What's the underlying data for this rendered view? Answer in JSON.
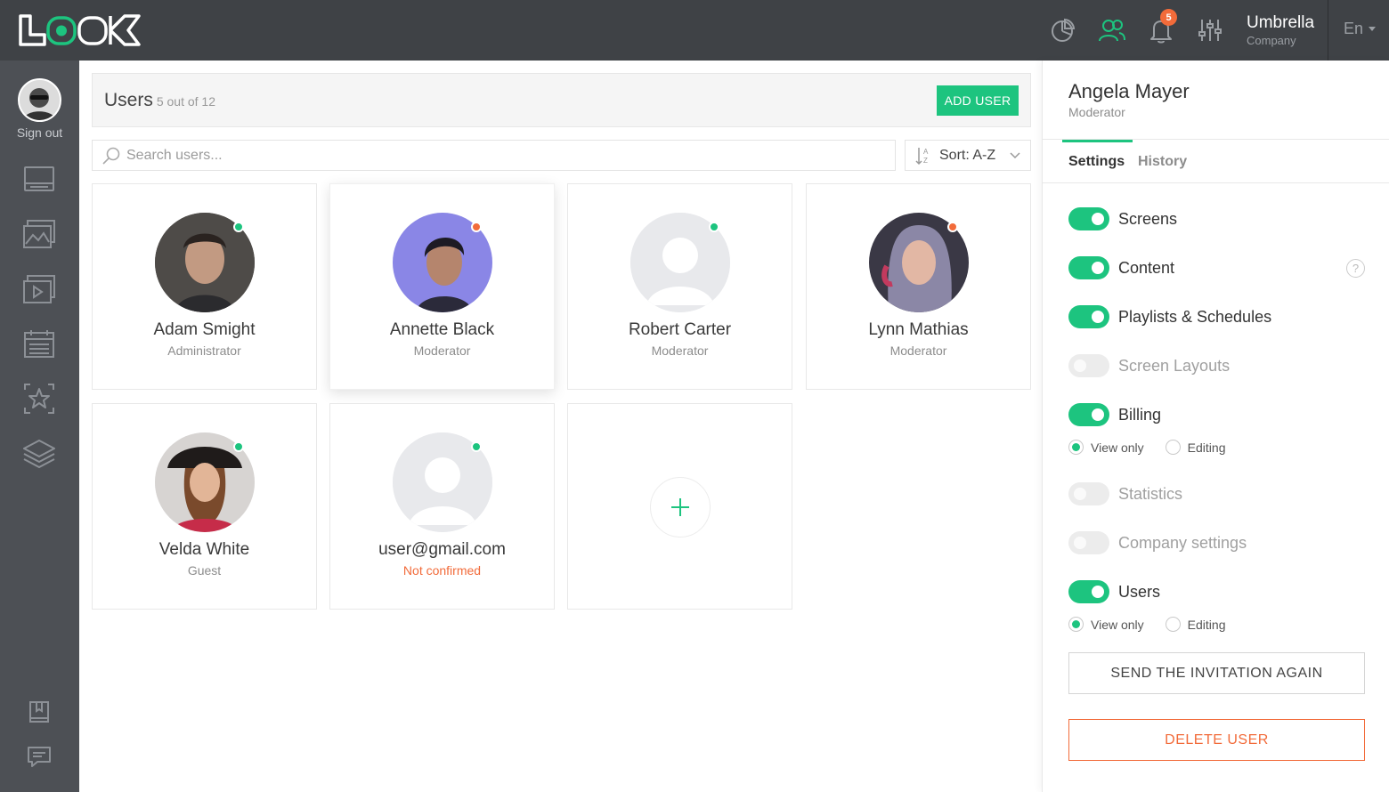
{
  "topbar": {
    "notifications_count": "5",
    "company_name": "Umbrella",
    "company_sub": "Company",
    "language": "En"
  },
  "sidebar": {
    "sign_out": "Sign out"
  },
  "header": {
    "title": "Users",
    "count": "5 out of 12",
    "add_user": "ADD USER"
  },
  "search": {
    "placeholder": "Search users...",
    "sort_label": "Sort: A-Z"
  },
  "users": [
    {
      "name": "Adam Smight",
      "role": "Administrator",
      "status_color": "#1dc47f"
    },
    {
      "name": "Annette Black",
      "role": "Moderator",
      "status_color": "#f26b3a"
    },
    {
      "name": "Robert Carter",
      "role": "Moderator",
      "status_color": "#1dc47f"
    },
    {
      "name": "Lynn Mathias",
      "role": "Moderator",
      "status_color": "#f26b3a"
    },
    {
      "name": "Velda White",
      "role": "Guest",
      "status_color": "#1dc47f"
    },
    {
      "name": "user@gmail.com",
      "role": "Not confirmed",
      "status_color": "#1dc47f"
    }
  ],
  "panel": {
    "name": "Angela Mayer",
    "role": "Moderator",
    "tabs": [
      "Settings",
      "History"
    ],
    "permissions": [
      {
        "label": "Screens",
        "on": true
      },
      {
        "label": "Content",
        "on": true
      },
      {
        "label": "Playlists & Schedules",
        "on": true
      },
      {
        "label": "Screen Layouts",
        "on": false
      },
      {
        "label": "Billing",
        "on": true
      },
      {
        "label": "Statistics",
        "on": false
      },
      {
        "label": "Company settings",
        "on": false
      },
      {
        "label": "Users",
        "on": true
      }
    ],
    "help_mark": "?",
    "radio_view": "View only",
    "radio_edit": "Editing",
    "send_invite": "SEND THE INVITATION AGAIN",
    "delete_user": "DELETE USER"
  },
  "colors": {
    "accent": "#1dc47f",
    "danger": "#f26b3a",
    "topbar": "#3f4246",
    "sidebar": "#4d5055"
  }
}
